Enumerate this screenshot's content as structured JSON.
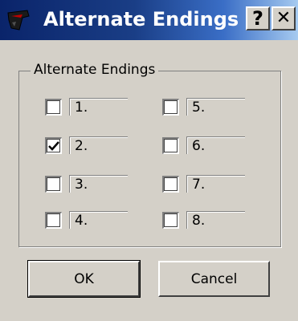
{
  "window": {
    "title": "Alternate Endings",
    "help_label": "?",
    "close_label": "✕"
  },
  "group": {
    "label": "Alternate Endings"
  },
  "endings": [
    {
      "label": "1.",
      "checked": false
    },
    {
      "label": "2.",
      "checked": true
    },
    {
      "label": "3.",
      "checked": false
    },
    {
      "label": "4.",
      "checked": false
    },
    {
      "label": "5.",
      "checked": false
    },
    {
      "label": "6.",
      "checked": false
    },
    {
      "label": "7.",
      "checked": false
    },
    {
      "label": "8.",
      "checked": false
    }
  ],
  "buttons": {
    "ok_label": "OK",
    "cancel_label": "Cancel"
  }
}
